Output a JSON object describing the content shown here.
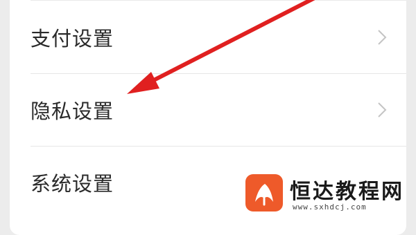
{
  "settings_list": {
    "items": [
      {
        "label": "支付设置",
        "has_chevron": true
      },
      {
        "label": "隐私设置",
        "has_chevron": true
      },
      {
        "label": "系统设置",
        "has_chevron": false
      }
    ]
  },
  "annotation": {
    "arrow_color": "#e02020",
    "target": "隐私设置"
  },
  "watermark": {
    "title": "恒达教程网",
    "url": "www.sxhdcj.com",
    "logo_color": "#ee5a2a"
  }
}
